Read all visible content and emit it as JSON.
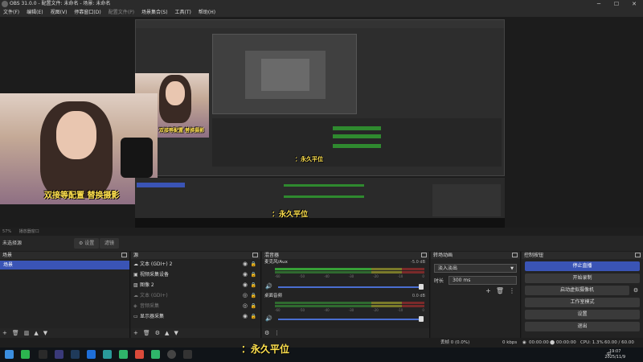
{
  "window": {
    "title": "OBS 31.0.0 - 配置文件: 未命名 - 场景: 未命名",
    "minimize": "─",
    "maximize": "☐",
    "close": "✕"
  },
  "menu": [
    "文件(F)",
    "编辑(E)",
    "视图(V)",
    "停靠窗口(D)",
    "配置文件(P)",
    "场景集合(S)",
    "工具(T)",
    "帮助(H)"
  ],
  "preview": {
    "subtitle_main": "双接等配置 替换摄影",
    "subtitle_small": "双接等配置 替换摄影",
    "subtitle_nested": "：永久平位"
  },
  "statusbar_top": {
    "zoom": "57%",
    "label": "播放器窗口"
  },
  "scene_bar": {
    "label": "未选择源",
    "settings": "⚙ 设置",
    "filters": "滤镜"
  },
  "docks": {
    "scenes": {
      "title": "场景",
      "items": [
        "场景"
      ]
    },
    "sources": {
      "title": "源",
      "items": [
        {
          "icon": "☁",
          "name": "文本 (GDI+) 2",
          "dim": false
        },
        {
          "icon": "▣",
          "name": "视频采集设备",
          "dim": false
        },
        {
          "icon": "▨",
          "name": "图像 2",
          "dim": false
        },
        {
          "icon": "☁",
          "name": "文本 (GDI+)",
          "dim": true
        },
        {
          "icon": "◈",
          "name": "音频采集",
          "dim": true
        },
        {
          "icon": "▭",
          "name": "显示器采集",
          "dim": false
        }
      ]
    },
    "mixer": {
      "title": "混音器",
      "channels": [
        {
          "name": "麦克风/Aux",
          "db": "-5.0 dB"
        },
        {
          "name": "桌面音频",
          "db": "0.0 dB"
        }
      ],
      "scale": [
        "-60",
        "-55",
        "-50",
        "-45",
        "-40",
        "-35",
        "-30",
        "-25",
        "-20",
        "-15",
        "-10",
        "-5",
        "0"
      ]
    },
    "transitions": {
      "title": "转场动画",
      "selected": "淡入淡出",
      "duration_label": "时长",
      "duration_value": "300 ms"
    },
    "controls": {
      "title": "控制按钮",
      "buttons": {
        "stop_stream": "停止直播",
        "start_record": "开始录制",
        "virtual_cam": "启动虚拟摄像机",
        "studio_mode": "工作室模式",
        "settings": "设置",
        "exit": "退出"
      }
    }
  },
  "status": {
    "frames": "丢帧 0 (0.0%)",
    "bitrate": "0 kbps",
    "stream_time": "00:00:00",
    "rec_time": "00:00:00",
    "cpu": "CPU: 1.3%",
    "fps": "60.00 / 60.00 FPS"
  },
  "taskbar": {
    "time": "19:07",
    "date": "2025/11/9",
    "lang": "中"
  }
}
